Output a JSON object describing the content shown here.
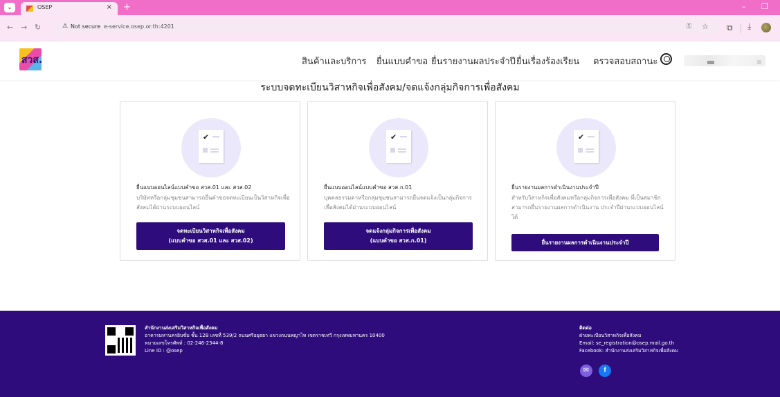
{
  "browser": {
    "tab_title": "OSEP",
    "tab_close": "×",
    "new_tab": "+",
    "not_secure": "Not secure",
    "url": "e-service.osep.or.th:4201"
  },
  "header": {
    "logo_text": "สวส.",
    "menu": [
      "สินค้าและบริการ",
      "ยื่นแบบคำขอ",
      "ยื่นรายงานผลประจำปี",
      "ยื่นเรื่องร้องเรียน",
      "ตรวจสอบสถานะ"
    ]
  },
  "main": {
    "title": "ระบบจดทะเบียนวิสาหกิจเพื่อสังคม/จดแจ้งกลุ่มกิจการเพื่อสังคม",
    "cards": [
      {
        "title": "ยื่นแบบออนไลน์แบบคำขอ สวส.01 และ สวส.02",
        "desc": "บริษัทหรือกลุ่มชุมชนสามารถยื่นคำขอจดทะเบียนเป็นวิสาหกิจเพื่อสังคมได้ผ่านระบบออนไลน์",
        "btn_line1": "จดทะเบียนวิสาหกิจเพื่อสังคม",
        "btn_line2": "(แบบคำขอ สวส.01 และ สวส.02)"
      },
      {
        "title": "ยื่นแบบออนไลน์แบบคำขอ สวส.ก.01",
        "desc": "บุคคลธรรมดาหรือกลุ่มชุมชนสามารถยื่นจดแจ้งเป็นกลุ่มกิจการเพื่อสังคมได้ผ่านระบบออนไลน์",
        "btn_line1": "จดแจ้งกลุ่มกิจการเพื่อสังคม",
        "btn_line2": "(แบบคำขอ สวส.ก.01)"
      },
      {
        "title": "ยื่นรายงานผลการดำเนินงานประจำปี",
        "desc": "สำหรับวิสาหกิจเพื่อสังคมหรือกลุ่มกิจการเพื่อสังคม ที่เป็นสมาชิกสามารถยื่นรายงานผลการดำเนินงาน ประจำปีผ่านระบบออนไลน์ได้",
        "btn_line1": "ยื่นรายงานผลการดำเนินงานประจำปี",
        "btn_line2": ""
      }
    ]
  },
  "footer": {
    "org_name": "สำนักงานส่งเสริมวิสาหกิจเพื่อสังคม",
    "address": "อาคารมหานครยิบซั่ม ชั้น 12B เลขที่ 539/2 ถนนศรีอยุธยา แขวงถนนพญาไท เขตราชเทวี กรุงเทพมหานคร 10400",
    "phone": "หมายเลขโทรศัพท์ : 02-246-2344-8",
    "line": "Line ID : @osep",
    "contact_title": "ติดต่อ",
    "contact_dept": "ฝ่ายทะเบียนวิสาหกิจเพื่อสังคม",
    "contact_email": "Email: se_registration@osep.mail.go.th",
    "contact_facebook": "Facebook: สำนักงานส่งเสริมวิสาหกิจเพื่อสังคม"
  }
}
